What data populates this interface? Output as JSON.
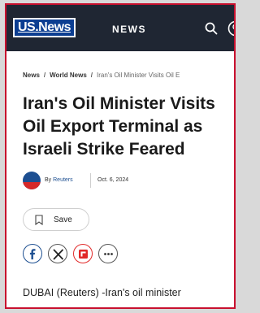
{
  "header": {
    "logo_brand": "US.News",
    "nav_label": "NEWS",
    "background_color": "#1f2633",
    "logo_color": "#0b3d91",
    "search_icon": "search-icon",
    "account_icon": "account-icon"
  },
  "breadcrumb": {
    "items": [
      "News",
      "World News",
      "Iran's Oil Minister Visits Oil E"
    ],
    "separator": "/"
  },
  "article": {
    "title": "Iran's Oil Minister Visits\nOil Export Terminal as\nIsraeli Strike Feared",
    "byline_prefix": "By",
    "source": "Reuters",
    "date": "Oct. 6, 2024",
    "lead": "DUBAI (Reuters) -Iran's oil minister"
  },
  "actions": {
    "save_label": "Save",
    "share_icons": [
      "facebook-icon",
      "x-twitter-icon",
      "flipboard-icon",
      "more-icon"
    ],
    "flipboard_color": "#e12828",
    "facebook_color": "#1d4f91"
  },
  "frame": {
    "border_color": "#c8102e"
  }
}
